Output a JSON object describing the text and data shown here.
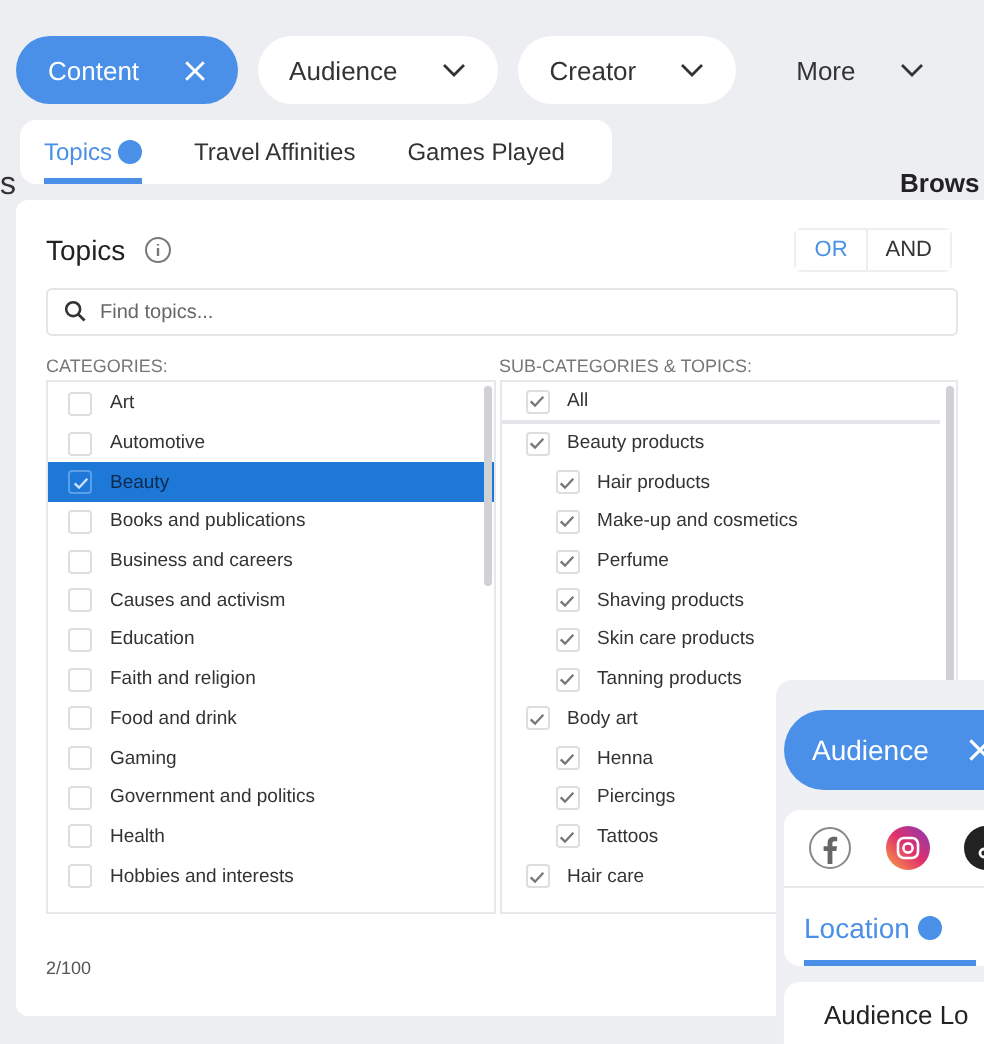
{
  "filters": [
    {
      "label": "Content",
      "kind": "chip",
      "selected": true
    },
    {
      "label": "Audience",
      "kind": "chip",
      "selected": false
    },
    {
      "label": "Creator",
      "kind": "chip",
      "selected": false
    },
    {
      "label": "More",
      "kind": "plain",
      "selected": false
    }
  ],
  "background": {
    "left_tab": "s",
    "browse": "Brows"
  },
  "topic_tabs": [
    {
      "label": "Topics",
      "selected": true,
      "active_dot": true
    },
    {
      "label": "Travel Affinities",
      "selected": false,
      "active_dot": false
    },
    {
      "label": "Games Played",
      "selected": false,
      "active_dot": false
    }
  ],
  "panel": {
    "title": "Topics",
    "logic": [
      {
        "label": "OR",
        "selected": true
      },
      {
        "label": "AND",
        "selected": false
      }
    ],
    "search": {
      "placeholder": "Find topics..."
    },
    "categories_label": "CATEGORIES:",
    "categories": [
      {
        "label": "Art",
        "checked": false,
        "selected": false
      },
      {
        "label": "Automotive",
        "checked": false,
        "selected": false
      },
      {
        "label": "Beauty",
        "checked": true,
        "selected": true
      },
      {
        "label": "Books and publications",
        "checked": false,
        "selected": false
      },
      {
        "label": "Business and careers",
        "checked": false,
        "selected": false
      },
      {
        "label": "Causes and activism",
        "checked": false,
        "selected": false
      },
      {
        "label": "Education",
        "checked": false,
        "selected": false
      },
      {
        "label": "Faith and religion",
        "checked": false,
        "selected": false
      },
      {
        "label": "Food and drink",
        "checked": false,
        "selected": false
      },
      {
        "label": "Gaming",
        "checked": false,
        "selected": false
      },
      {
        "label": "Government and politics",
        "checked": false,
        "selected": false
      },
      {
        "label": "Health",
        "checked": false,
        "selected": false
      },
      {
        "label": "Hobbies and interests",
        "checked": false,
        "selected": false
      }
    ],
    "subcategories_label": "SUB-CATEGORIES & TOPICS:",
    "subcategories": [
      {
        "label": "All",
        "checked": true,
        "kind": "all"
      },
      {
        "label": "Beauty products",
        "checked": true,
        "kind": "group",
        "children": [
          {
            "label": "Hair products",
            "checked": true
          },
          {
            "label": "Make-up and cosmetics",
            "checked": true
          },
          {
            "label": "Perfume",
            "checked": true
          },
          {
            "label": "Shaving products",
            "checked": true
          },
          {
            "label": "Skin care products",
            "checked": true
          },
          {
            "label": "Tanning products",
            "checked": true
          }
        ]
      },
      {
        "label": "Body art",
        "checked": true,
        "kind": "group",
        "children": [
          {
            "label": "Henna",
            "checked": true
          },
          {
            "label": "Piercings",
            "checked": true
          },
          {
            "label": "Tattoos",
            "checked": true
          }
        ]
      },
      {
        "label": "Hair care",
        "checked": true,
        "kind": "group"
      }
    ],
    "count": "2/100"
  },
  "overlay": {
    "chip": {
      "label": "Audience",
      "selected": true
    },
    "platforms": [
      {
        "kind": "facebook"
      },
      {
        "kind": "instagram"
      },
      {
        "kind": "tiktok"
      }
    ],
    "tab": {
      "label": "Location",
      "selected": true,
      "active_dot": true
    },
    "heading": "Audience Lo"
  }
}
